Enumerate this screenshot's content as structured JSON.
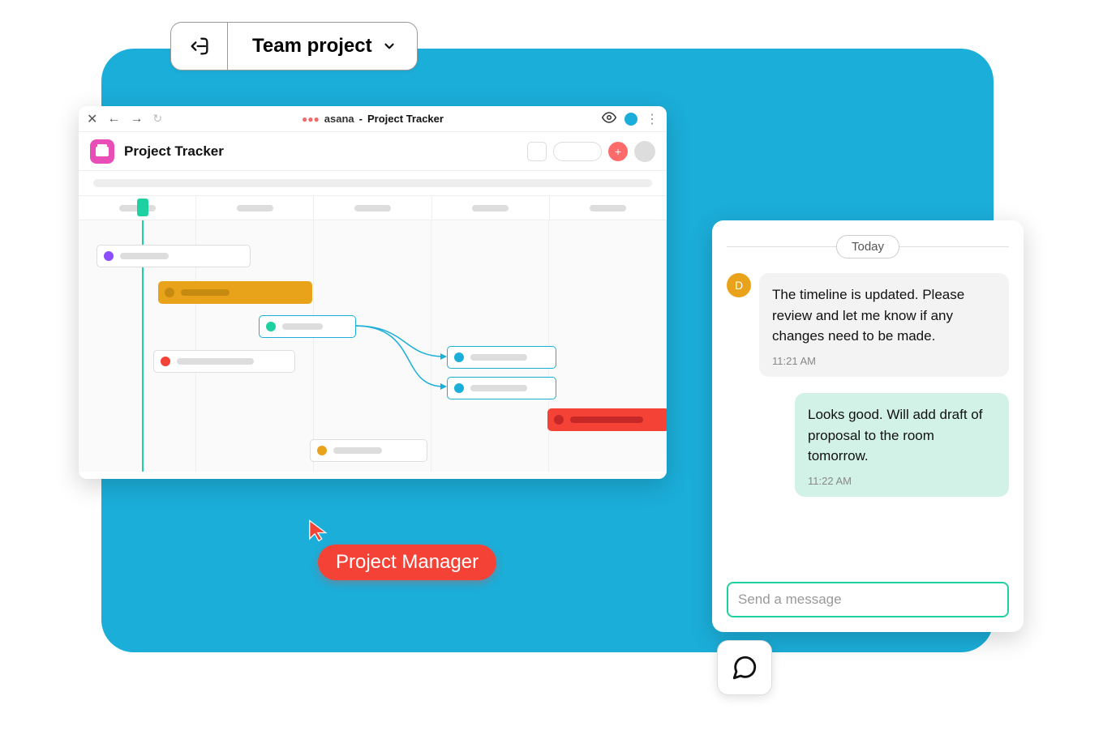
{
  "team_project": {
    "label": "Team project"
  },
  "browser": {
    "brand": "asana",
    "title_separator": "-",
    "tab_title": "Project Tracker"
  },
  "project": {
    "title": "Project Tracker"
  },
  "chat": {
    "date_label": "Today",
    "messages": [
      {
        "avatar_letter": "D",
        "text": "The timeline is updated. Please review and let me know if any changes need to be made.",
        "time": "11:21 AM"
      },
      {
        "text": "Looks good. Will add draft of proposal to the room tomorrow.",
        "time": "11:22 AM"
      }
    ],
    "input_placeholder": "Send a message"
  },
  "cursor": {
    "label": "Project Manager"
  },
  "colors": {
    "bg": "#1baed9",
    "teal": "#1dd1a1",
    "orange": "#e8a31a",
    "red": "#f44336",
    "pink": "#e94eb8"
  }
}
